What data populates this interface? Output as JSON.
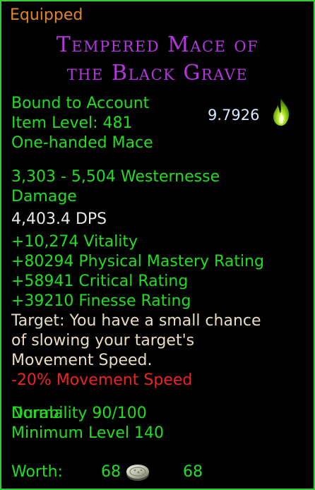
{
  "tooltip": {
    "status": "Equipped",
    "name_line1": "Tempered Mace of",
    "name_line2": "the Black Grave",
    "binding": "Bound to Account",
    "item_level": "Item Level: 481",
    "item_type": "One-handed Mace",
    "essence_value": "9.7926",
    "damage_line1": "3,303 - 5,504 Westernesse",
    "damage_line2": "Damage",
    "dps": "4,403.4 DPS",
    "stats": [
      "+10,274 Vitality",
      "+80294 Physical Mastery Rating",
      "+58941 Critical Rating",
      "+39210 Finesse Rating"
    ],
    "effect_lines": [
      "Target: You have a small chance",
      "of slowing your target's",
      "Movement Speed."
    ],
    "debuff": "-20% Movement Speed",
    "durability": "Durability 90/100",
    "durability_quality": "Normal",
    "min_level": "Minimum Level 140",
    "worth_label": "Worth:",
    "worth_silver": "68",
    "worth_copper": "68"
  },
  "colors": {
    "border": "#33cc33",
    "status": "#e0852e",
    "name": "#b437e0",
    "stat_green": "#22dd22",
    "debuff_red": "#ee2222"
  },
  "icons": [
    "green-flame-icon",
    "silver-coin-icon"
  ]
}
